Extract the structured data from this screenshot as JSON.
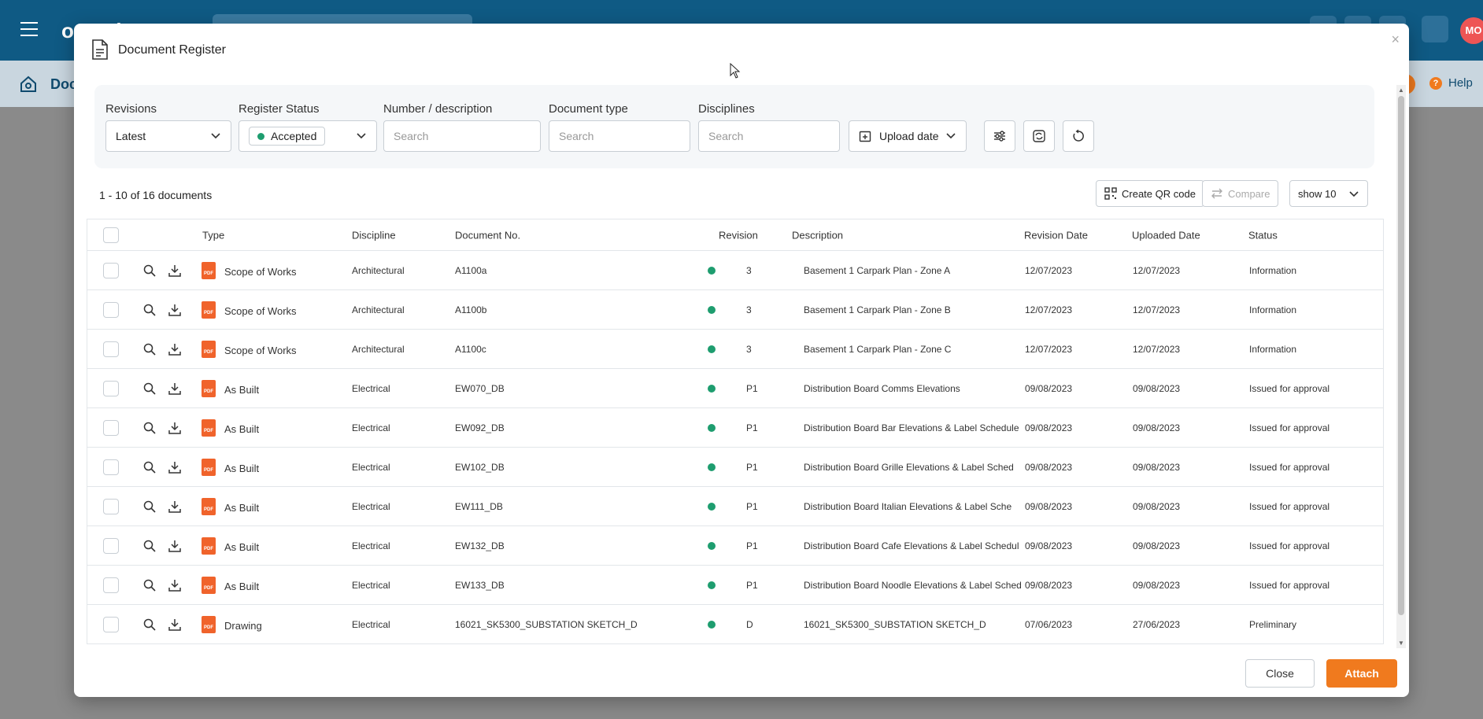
{
  "app": {
    "logo_text": "oomaic",
    "avatar_text": "MO",
    "page_title_partial": "Doc",
    "help_label": "Help"
  },
  "modal": {
    "title": "Document Register",
    "close_glyph": "×"
  },
  "filters": {
    "revisions": {
      "label": "Revisions",
      "value": "Latest"
    },
    "register_status": {
      "label": "Register Status",
      "value": "Accepted"
    },
    "number_description": {
      "label": "Number / description",
      "placeholder": "Search"
    },
    "document_type": {
      "label": "Document type",
      "placeholder": "Search"
    },
    "disciplines": {
      "label": "Disciplines",
      "placeholder": "Search"
    },
    "sort": {
      "value": "Upload date"
    }
  },
  "toolbar": {
    "count_text": "1 - 10 of 16 documents",
    "create_qr_label": "Create QR code",
    "compare_label": "Compare",
    "page_size_label": "show 10"
  },
  "table": {
    "columns": [
      "Type",
      "Discipline",
      "Document No.",
      "Revision",
      "Description",
      "Revision Date",
      "Uploaded Date",
      "Status"
    ],
    "rows": [
      {
        "type": "Scope of Works",
        "discipline": "Architectural",
        "doc_no": "A1100a",
        "revision": "3",
        "description": "Basement 1 Carpark Plan - Zone A",
        "revision_date": "12/07/2023",
        "uploaded_date": "12/07/2023",
        "status": "Information"
      },
      {
        "type": "Scope of Works",
        "discipline": "Architectural",
        "doc_no": "A1100b",
        "revision": "3",
        "description": "Basement 1 Carpark Plan - Zone B",
        "revision_date": "12/07/2023",
        "uploaded_date": "12/07/2023",
        "status": "Information"
      },
      {
        "type": "Scope of Works",
        "discipline": "Architectural",
        "doc_no": "A1100c",
        "revision": "3",
        "description": "Basement 1 Carpark Plan - Zone C",
        "revision_date": "12/07/2023",
        "uploaded_date": "12/07/2023",
        "status": "Information"
      },
      {
        "type": "As Built",
        "discipline": "Electrical",
        "doc_no": "EW070_DB",
        "revision": "P1",
        "description": "Distribution Board Comms Elevations",
        "revision_date": "09/08/2023",
        "uploaded_date": "09/08/2023",
        "status": "Issued for approval"
      },
      {
        "type": "As Built",
        "discipline": "Electrical",
        "doc_no": "EW092_DB",
        "revision": "P1",
        "description": "Distribution Board Bar Elevations & Label Schedule",
        "revision_date": "09/08/2023",
        "uploaded_date": "09/08/2023",
        "status": "Issued for approval"
      },
      {
        "type": "As Built",
        "discipline": "Electrical",
        "doc_no": "EW102_DB",
        "revision": "P1",
        "description": "Distribution Board Grille Elevations & Label Sched",
        "revision_date": "09/08/2023",
        "uploaded_date": "09/08/2023",
        "status": "Issued for approval"
      },
      {
        "type": "As Built",
        "discipline": "Electrical",
        "doc_no": "EW111_DB",
        "revision": "P1",
        "description": "Distribution Board Italian Elevations & Label Sche",
        "revision_date": "09/08/2023",
        "uploaded_date": "09/08/2023",
        "status": "Issued for approval"
      },
      {
        "type": "As Built",
        "discipline": "Electrical",
        "doc_no": "EW132_DB",
        "revision": "P1",
        "description": "Distribution Board Cafe Elevations & Label Schedul",
        "revision_date": "09/08/2023",
        "uploaded_date": "09/08/2023",
        "status": "Issued for approval"
      },
      {
        "type": "As Built",
        "discipline": "Electrical",
        "doc_no": "EW133_DB",
        "revision": "P1",
        "description": "Distribution Board Noodle Elevations & Label Sched",
        "revision_date": "09/08/2023",
        "uploaded_date": "09/08/2023",
        "status": "Issued for approval"
      },
      {
        "type": "Drawing",
        "discipline": "Electrical",
        "doc_no": "16021_SK5300_SUBSTATION SKETCH_D",
        "revision": "D",
        "description": "16021_SK5300_SUBSTATION SKETCH_D",
        "revision_date": "07/06/2023",
        "uploaded_date": "27/06/2023",
        "status": "Preliminary"
      }
    ],
    "file_badge": "PDF"
  },
  "footer": {
    "close_label": "Close",
    "attach_label": "Attach"
  },
  "colors": {
    "brand_blue": "#0f5a84",
    "accent_orange": "#f07a1e",
    "status_green": "#1e9d6f"
  }
}
